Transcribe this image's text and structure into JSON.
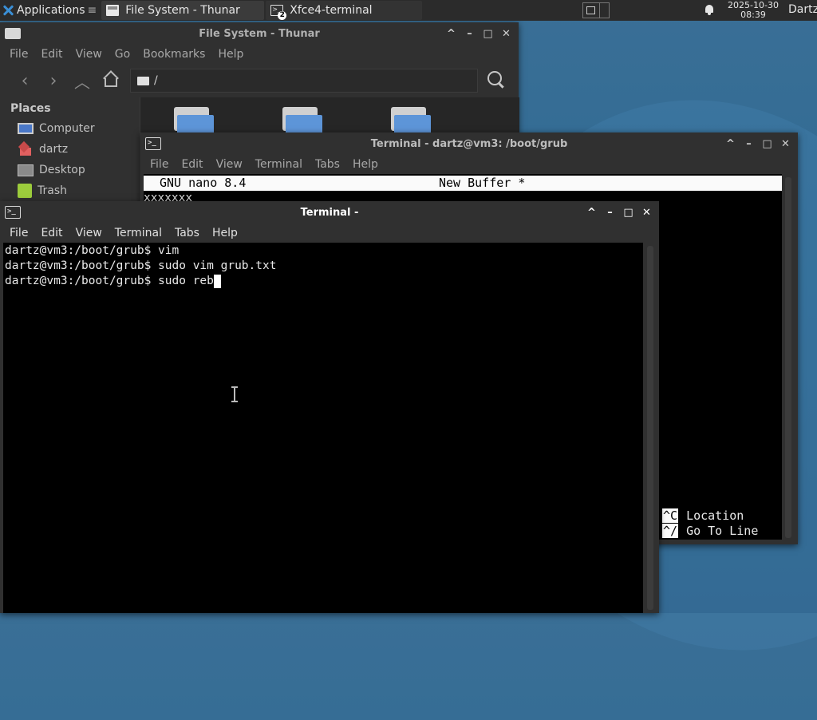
{
  "panel": {
    "applications_label": "Applications",
    "applications_suffix": "≡",
    "tasks": [
      {
        "label": "File System - Thunar"
      },
      {
        "label": "Xfce4-terminal",
        "badge": "2"
      }
    ],
    "clock_date": "2025-10-30",
    "clock_time": "08:39",
    "user": "Dartz"
  },
  "thunar": {
    "title": "File System - Thunar",
    "menu": [
      "File",
      "Edit",
      "View",
      "Go",
      "Bookmarks",
      "Help"
    ],
    "location": "/",
    "places_header": "Places",
    "places": [
      "Computer",
      "dartz",
      "Desktop",
      "Trash"
    ]
  },
  "term_back": {
    "title": "Terminal - dartz@vm3: /boot/grub",
    "menu": [
      "File",
      "Edit",
      "View",
      "Terminal",
      "Tabs",
      "Help"
    ],
    "nano_version": "GNU nano 8.4",
    "nano_buffer": "New Buffer *",
    "nano_text": "xxxxxxx",
    "shortcuts": [
      {
        "key": "^C",
        "label": "Location"
      },
      {
        "key": "^/",
        "label": "Go To Line"
      }
    ]
  },
  "term_front": {
    "title": "Terminal -",
    "menu": [
      "File",
      "Edit",
      "View",
      "Terminal",
      "Tabs",
      "Help"
    ],
    "lines": [
      "dartz@vm3:/boot/grub$ vim",
      "dartz@vm3:/boot/grub$ sudo vim grub.txt",
      "dartz@vm3:/boot/grub$ sudo reb"
    ]
  },
  "window_buttons": {
    "minimize": "–",
    "restore": "^",
    "maximize": "□",
    "close": "✕"
  },
  "colors": {
    "panel_bg": "#2b2b2b",
    "window_bg": "#303030",
    "terminal_bg": "#000000",
    "desktop_bg": "#2f6a93",
    "folder_blue": "#5d95d8"
  }
}
